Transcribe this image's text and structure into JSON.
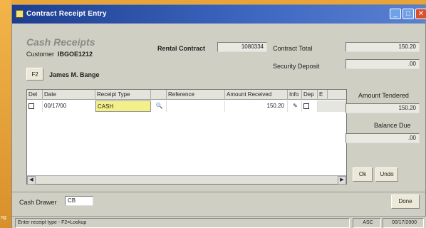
{
  "window": {
    "title": "Contract Receipt Entry"
  },
  "header": {
    "cash_title": "Cash Receipts",
    "customer_label": "Customer",
    "customer_id": "IBGOE1212",
    "find_button": "F2",
    "customer_name": "James M. Bange",
    "rental_contract_label": "Rental Contract",
    "rental_contract_value": "1080334",
    "contract_total_label": "Contract Total",
    "contract_total_value": "150.20",
    "security_deposit_label": "Security Deposit",
    "security_deposit_value": ".00"
  },
  "grid": {
    "columns": [
      "Del",
      "Date",
      "Receipt Type",
      "",
      "Reference",
      "Amount Received",
      "Info",
      "Dep",
      "E"
    ],
    "rows": [
      {
        "del": false,
        "date": "00/17/00",
        "receipt_type": "CASH",
        "reference": "",
        "amount": "150.20",
        "dep": false
      }
    ]
  },
  "summary": {
    "amount_tendered_label": "Amount Tendered",
    "amount_tendered_value": "150.20",
    "balance_due_label": "Balance Due",
    "balance_due_value": ".00",
    "ok_button": "Ok",
    "undo_button": "Undo"
  },
  "footer": {
    "cash_drawer_label": "Cash Drawer",
    "cash_drawer_value": "CB",
    "done_button": "Done"
  },
  "statusbar": {
    "message": "Enter receipt type - F2=Lookup",
    "left_tag": "ng",
    "mode": "ASC",
    "date": "00/17/2000"
  },
  "colors": {
    "title_bar": "#1d3e8f",
    "receipt_type_highlight": "#f3f08a",
    "background_accent": "#e8a33a"
  }
}
